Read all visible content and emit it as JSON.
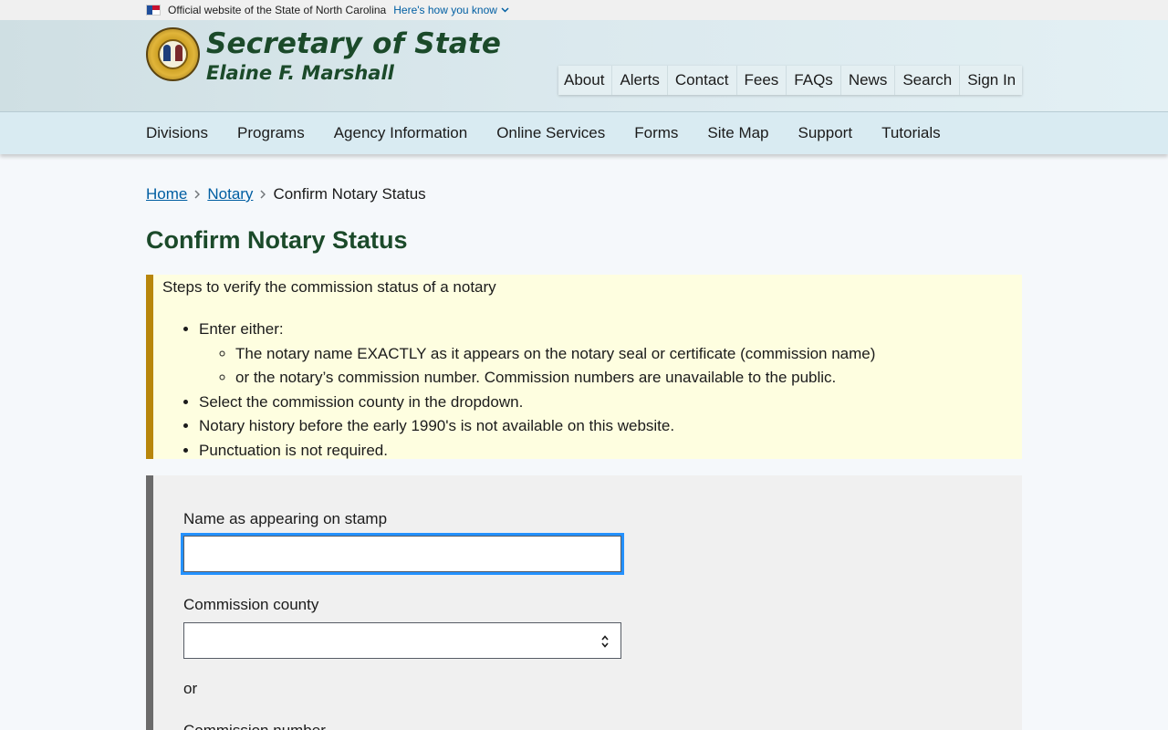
{
  "banner": {
    "official_text": "Official website of the State of North Carolina",
    "how_you_know": "Here's how you know"
  },
  "header": {
    "title": "Secretary of State",
    "subtitle": "Elaine F. Marshall",
    "utility_nav": [
      "About",
      "Alerts",
      "Contact",
      "Fees",
      "FAQs",
      "News",
      "Search",
      "Sign In"
    ]
  },
  "main_nav": [
    "Divisions",
    "Programs",
    "Agency Information",
    "Online Services",
    "Forms",
    "Site Map",
    "Support",
    "Tutorials"
  ],
  "breadcrumb": {
    "home": "Home",
    "notary": "Notary",
    "current": "Confirm Notary Status"
  },
  "page_title": "Confirm Notary Status",
  "info": {
    "intro": "Steps to verify the commission status of a notary",
    "item1": "Enter either:",
    "sub1": "The notary name EXACTLY as it appears on the notary seal or certificate (commission name)",
    "sub2": "or the notary’s commission number. Commission numbers are unavailable to the public.",
    "item2": "Select the commission county in the dropdown.",
    "item3": "Notary history before the early 1990's is not available on this website.",
    "item4": "Punctuation is not required."
  },
  "form": {
    "name_label": "Name as appearing on stamp",
    "name_value": "",
    "county_label": "Commission county",
    "county_value": "",
    "or_text": "or",
    "number_label": "Commission number"
  },
  "colors": {
    "title_green": "#1b4a2a",
    "link_blue": "#005ea2",
    "info_border": "#b8860b",
    "focus_ring": "#2491ff"
  }
}
